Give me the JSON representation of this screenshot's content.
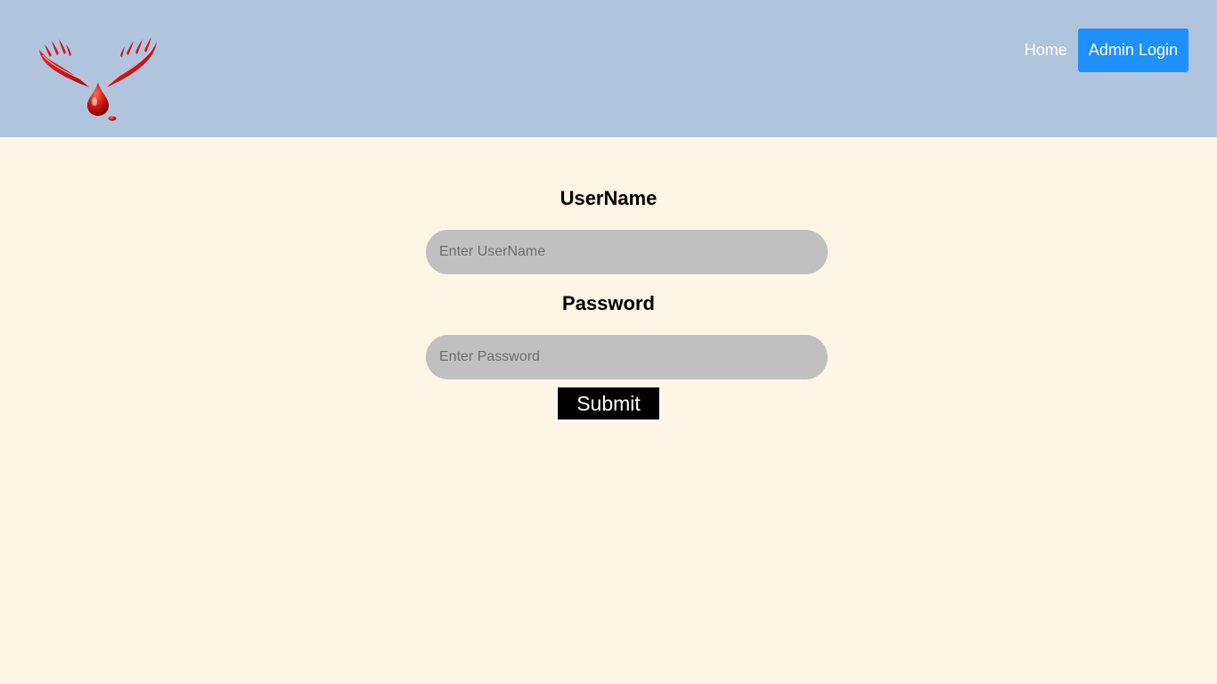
{
  "header": {
    "logo_icon": "blood-drop-hands-logo",
    "nav": {
      "home_label": "Home",
      "admin_login_label": "Admin Login"
    }
  },
  "form": {
    "username_label": "UserName",
    "username_placeholder": "Enter UserName",
    "username_value": "",
    "password_label": "Password",
    "password_placeholder": "Enter Password",
    "password_value": "",
    "submit_label": "Submit"
  },
  "colors": {
    "header_bg": "#b0c4de",
    "page_bg": "#fdf5e6",
    "admin_button_bg": "#1e90ff",
    "input_bg": "#c0c0c0",
    "submit_bg": "#000000",
    "logo_red": "#d0161b"
  }
}
